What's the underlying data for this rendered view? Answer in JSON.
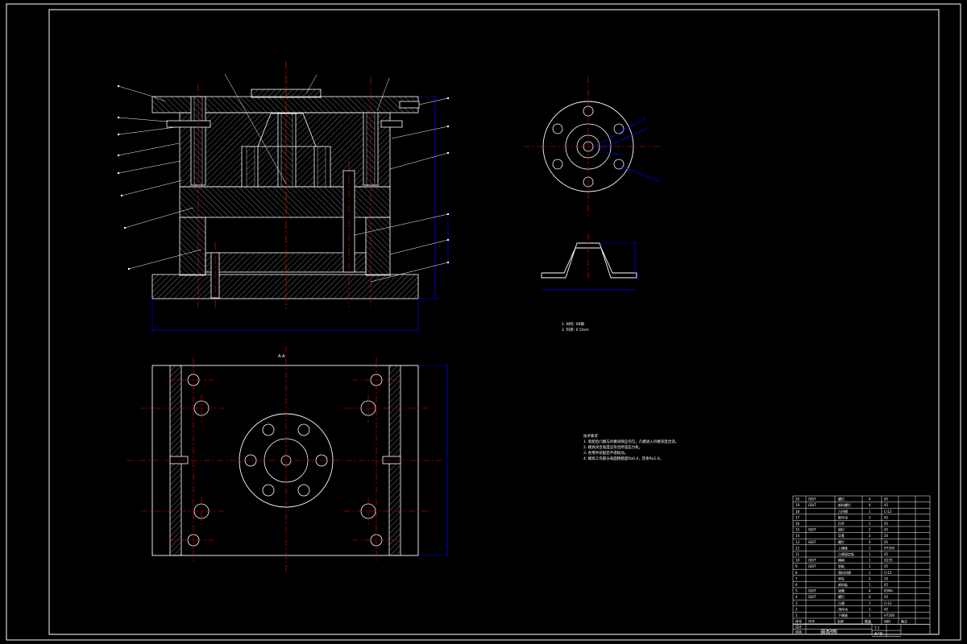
{
  "sheet": {
    "background": "#000000",
    "line_color": "#ffffff",
    "center_color": "#ff0000",
    "dim_color": "#0000ff",
    "hatch_color": "#cccccc"
  },
  "section_view": {
    "label": "A-A"
  },
  "part_notes": {
    "lines": [
      "1. 材料: 08钢",
      "2. 料厚: 0.5mm"
    ]
  },
  "tech_req": {
    "heading": "技术要求",
    "lines": [
      "1. 装配后凸模与凹模间隙应均匀，凸模进入凹模深度合适。",
      "2. 模具闭合高度应符合所选压力机。",
      "3. 各零件装配后不得松动。",
      "4. 模具工作部分表面粗糙度Ra0.4，其余Ra1.6。"
    ]
  },
  "title_block": {
    "drawing_name": "装配图",
    "scale": "1:1",
    "sheet_label": "共1张",
    "rows": [
      [
        "20",
        "GB/T",
        "螺钉",
        "4",
        "45",
        ""
      ],
      [
        "19",
        "GB/T",
        "卸料螺钉",
        "4",
        "45",
        ""
      ],
      [
        "18",
        "",
        "凸凹模",
        "1",
        "Cr12",
        ""
      ],
      [
        "17",
        "",
        "推件块",
        "1",
        "45",
        ""
      ],
      [
        "16",
        "",
        "打杆",
        "1",
        "45",
        ""
      ],
      [
        "15",
        "GB/T",
        "销钉",
        "2",
        "45",
        ""
      ],
      [
        "14",
        "",
        "导套",
        "2",
        "20",
        ""
      ],
      [
        "13",
        "GB/T",
        "螺钉",
        "4",
        "45",
        ""
      ],
      [
        "12",
        "",
        "上模座",
        "1",
        "HT200",
        ""
      ],
      [
        "11",
        "",
        "凸模固定板",
        "1",
        "45",
        ""
      ],
      [
        "10",
        "GB/T",
        "模柄",
        "1",
        "Q235",
        ""
      ],
      [
        "9",
        "GB/T",
        "垫板",
        "1",
        "45",
        ""
      ],
      [
        "8",
        "",
        "落料凹模",
        "1",
        "Cr12",
        ""
      ],
      [
        "7",
        "",
        "导柱",
        "2",
        "20",
        ""
      ],
      [
        "6",
        "",
        "卸料板",
        "1",
        "45",
        ""
      ],
      [
        "5",
        "GB/T",
        "弹簧",
        "4",
        "65Mn",
        ""
      ],
      [
        "4",
        "GB/T",
        "螺钉",
        "4",
        "45",
        ""
      ],
      [
        "3",
        "",
        "凸模",
        "1",
        "Cr12",
        ""
      ],
      [
        "2",
        "",
        "顶件块",
        "1",
        "45",
        ""
      ],
      [
        "1",
        "",
        "下模座",
        "1",
        "HT200",
        ""
      ]
    ],
    "header": [
      "序号",
      "代号",
      "名称",
      "数量",
      "材料",
      "备注"
    ],
    "sign_rows": [
      "设计",
      "审核"
    ]
  }
}
